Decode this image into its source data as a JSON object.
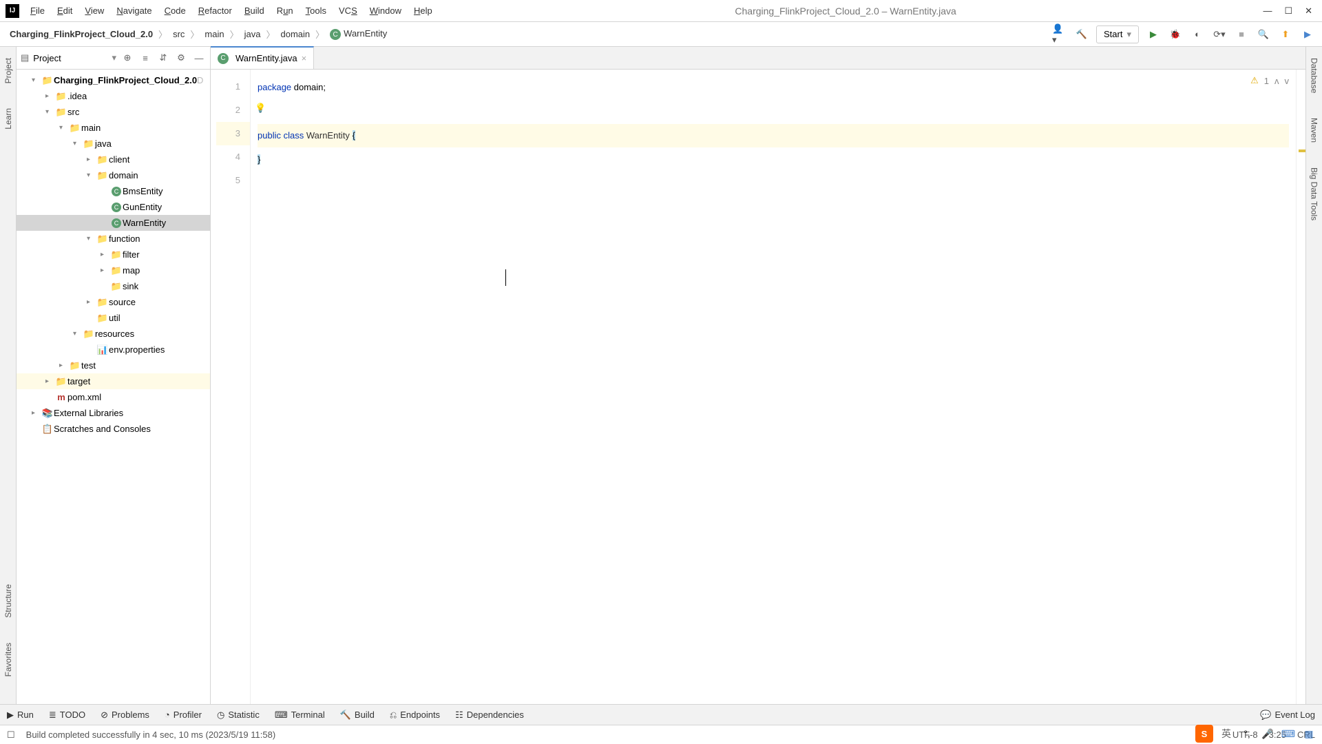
{
  "window": {
    "title": "Charging_FlinkProject_Cloud_2.0 – WarnEntity.java"
  },
  "menu": [
    "File",
    "Edit",
    "View",
    "Navigate",
    "Code",
    "Refactor",
    "Build",
    "Run",
    "Tools",
    "VCS",
    "Window",
    "Help"
  ],
  "breadcrumb": {
    "root": "Charging_FlinkProject_Cloud_2.0",
    "parts": [
      "src",
      "main",
      "java",
      "domain"
    ],
    "leaf": "WarnEntity"
  },
  "toolbar": {
    "run_config": "Start"
  },
  "left_labels": [
    "Project",
    "Learn",
    "Structure",
    "Favorites"
  ],
  "right_labels": [
    "Database",
    "Maven",
    "Big Data Tools"
  ],
  "project_panel": {
    "title": "Project",
    "tree": [
      {
        "label": "Charging_FlinkProject_Cloud_2.0",
        "indent": 1,
        "arrow": "▾",
        "icon": "folder-blue",
        "bold": true,
        "suffix": " D"
      },
      {
        "label": ".idea",
        "indent": 2,
        "arrow": "▸",
        "icon": "folder"
      },
      {
        "label": "src",
        "indent": 2,
        "arrow": "▾",
        "icon": "folder"
      },
      {
        "label": "main",
        "indent": 3,
        "arrow": "▾",
        "icon": "folder-blue"
      },
      {
        "label": "java",
        "indent": 4,
        "arrow": "▾",
        "icon": "folder-blue"
      },
      {
        "label": "client",
        "indent": 5,
        "arrow": "▸",
        "icon": "folder"
      },
      {
        "label": "domain",
        "indent": 5,
        "arrow": "▾",
        "icon": "folder"
      },
      {
        "label": "BmsEntity",
        "indent": 6,
        "arrow": "",
        "icon": "class"
      },
      {
        "label": "GunEntity",
        "indent": 6,
        "arrow": "",
        "icon": "class"
      },
      {
        "label": "WarnEntity",
        "indent": 6,
        "arrow": "",
        "icon": "class",
        "selected": true
      },
      {
        "label": "function",
        "indent": 5,
        "arrow": "▾",
        "icon": "folder"
      },
      {
        "label": "filter",
        "indent": 6,
        "arrow": "▸",
        "icon": "folder"
      },
      {
        "label": "map",
        "indent": 6,
        "arrow": "▸",
        "icon": "folder"
      },
      {
        "label": "sink",
        "indent": 6,
        "arrow": "",
        "icon": "folder"
      },
      {
        "label": "source",
        "indent": 5,
        "arrow": "▸",
        "icon": "folder"
      },
      {
        "label": "util",
        "indent": 5,
        "arrow": "",
        "icon": "folder"
      },
      {
        "label": "resources",
        "indent": 4,
        "arrow": "▾",
        "icon": "folder-res"
      },
      {
        "label": "env.properties",
        "indent": 5,
        "arrow": "",
        "icon": "props"
      },
      {
        "label": "test",
        "indent": 3,
        "arrow": "▸",
        "icon": "folder"
      },
      {
        "label": "target",
        "indent": 2,
        "arrow": "▸",
        "icon": "folder-orange",
        "highlighted": true
      },
      {
        "label": "pom.xml",
        "indent": 2,
        "arrow": "",
        "icon": "maven"
      },
      {
        "label": "External Libraries",
        "indent": 1,
        "arrow": "▸",
        "icon": "lib"
      },
      {
        "label": "Scratches and Consoles",
        "indent": 1,
        "arrow": "",
        "icon": "scratch"
      }
    ]
  },
  "editor": {
    "tab": "WarnEntity.java",
    "line_numbers": [
      "1",
      "2",
      "3",
      "4",
      "5"
    ],
    "code": {
      "l1_kw": "package",
      "l1_rest": " domain;",
      "l3_kw1": "public",
      "l3_kw2": "class",
      "l3_name": "WarnEntity",
      "l3_brace": "{",
      "l4_brace": "}"
    },
    "warnings": "1"
  },
  "bottom_tools": [
    "Run",
    "TODO",
    "Problems",
    "Profiler",
    "Statistic",
    "Terminal",
    "Build",
    "Endpoints",
    "Dependencies"
  ],
  "bottom_right": "Event Log",
  "status": {
    "message": "Build completed successfully in 4 sec, 10 ms (2023/5/19 11:58)",
    "encoding": "UTF-8",
    "pos": "3:25",
    "line_ending": "CRL",
    "lang": "英"
  }
}
